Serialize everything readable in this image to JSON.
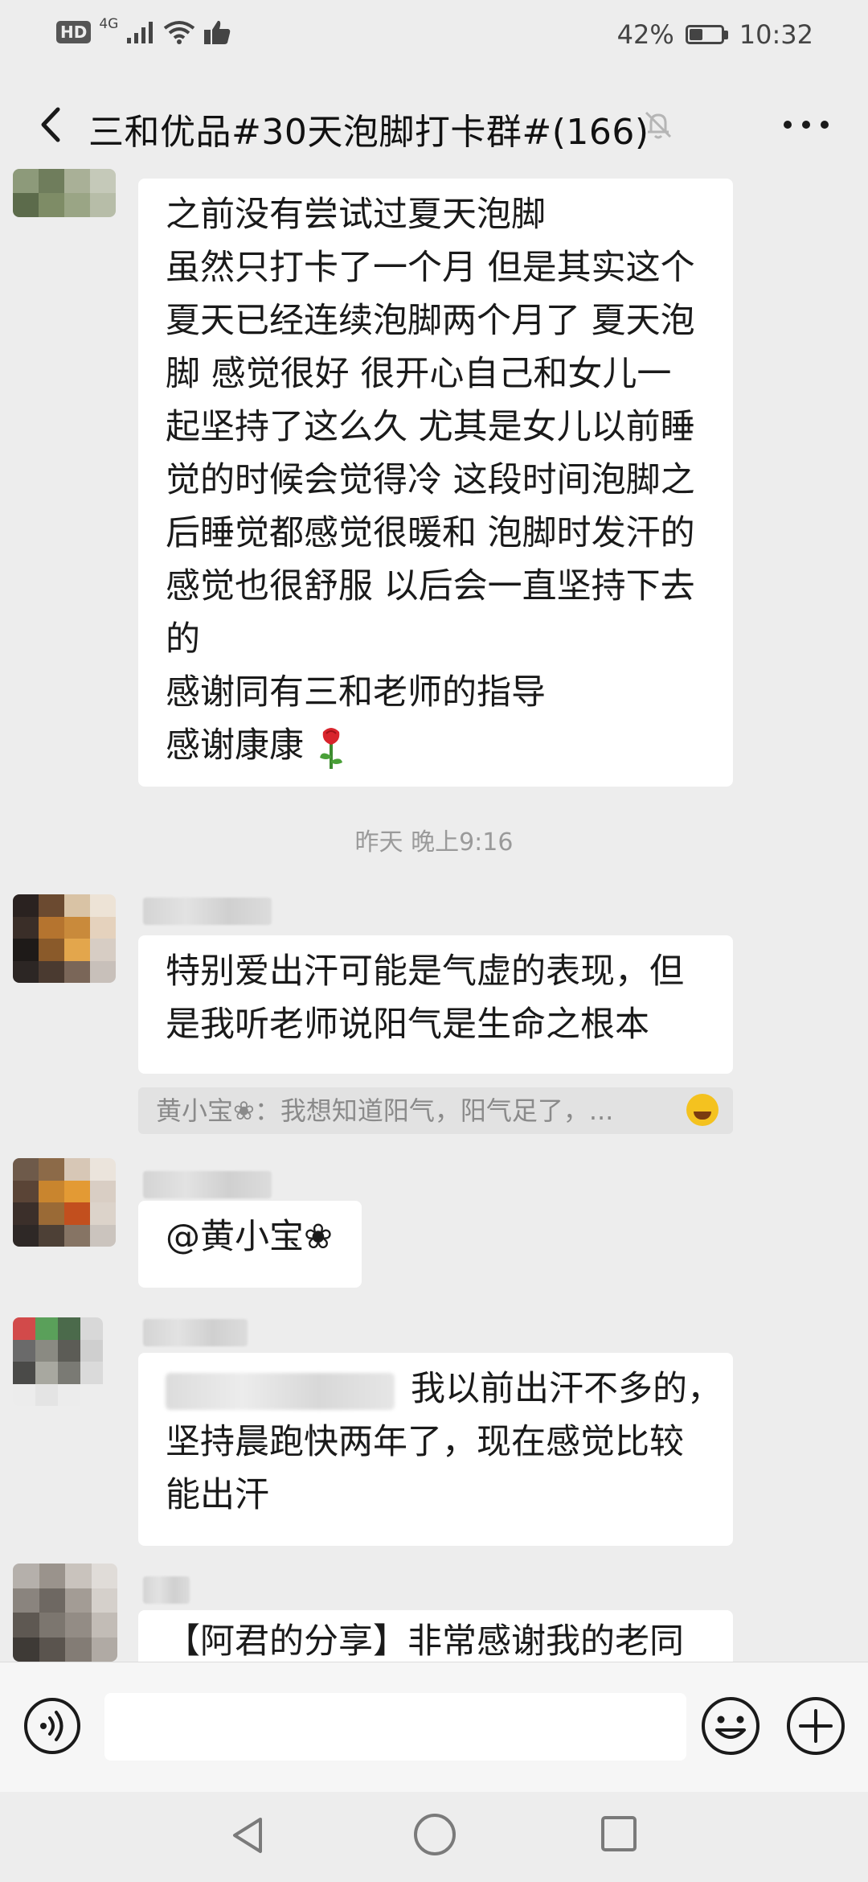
{
  "status_bar": {
    "hd": "HD",
    "network": "4G",
    "battery": "42%",
    "battery_level": 0.42,
    "time": "10:32"
  },
  "header": {
    "title": "三和优品#30天泡脚打卡群#(166)",
    "icons": [
      "back-arrow-icon",
      "mute-bell-icon",
      "more-dots-icon"
    ]
  },
  "messages": [
    {
      "type": "text",
      "lines": [
        "之前没有尝试过夏天泡脚",
        "虽然只打卡了一个月 但是其实这个",
        "夏天已经连续泡脚两个月了 夏天泡",
        "脚 感觉很好 很开心自己和女儿一",
        "起坚持了这么久 尤其是女儿以前睡",
        "觉的时候会觉得冷 这段时间泡脚之",
        "后睡觉都感觉很暖和 泡脚时发汗的",
        "感觉也很舒服 以后会一直坚持下去",
        "的",
        "感谢同有三和老师的指导",
        "感谢康康"
      ],
      "trailing_icon": "rose-icon"
    },
    {
      "type": "timestamp",
      "text": "昨天 晚上9:16"
    },
    {
      "type": "text",
      "lines": [
        "特别爱出汗可能是气虚的表现，但",
        "是我听老师说阳气是生命之根本"
      ],
      "quote": {
        "text": "黄小宝❀：我想知道阳气，阳气足了，...",
        "trailing_icon": "laughing-tears-icon"
      }
    },
    {
      "type": "text",
      "lines": [
        "@黄小宝❀"
      ]
    },
    {
      "type": "text",
      "lines": [
        "我以前出汗不多的，",
        "坚持晨跑快两年了，现在感觉比较",
        "能出汗"
      ]
    },
    {
      "type": "text",
      "lines": [
        "【阿君的分享】非常感谢我的老同"
      ]
    }
  ],
  "input_bar": {
    "placeholder": "",
    "icons": [
      "voice-icon",
      "emoji-icon",
      "plus-icon"
    ]
  },
  "nav_bar": {
    "icons": [
      "nav-back-icon",
      "nav-home-icon",
      "nav-recent-icon"
    ]
  },
  "colors": {
    "background": "#ededed",
    "bubble": "#ffffff",
    "timestamp": "#9a9a9a",
    "quote_bg": "#e2e2e2"
  }
}
